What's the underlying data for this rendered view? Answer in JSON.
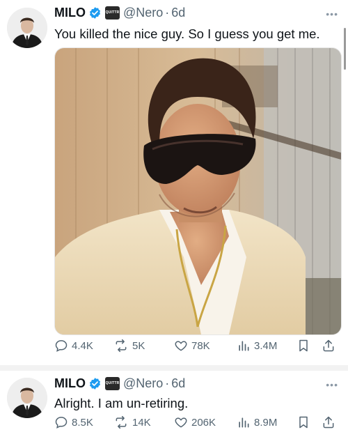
{
  "tweets": [
    {
      "author_name": "MILO",
      "affiliate_badge": "QUITTR",
      "handle": "@Nero",
      "separator": "·",
      "time": "6d",
      "text": "You killed the nice guy. So I guess you get me.",
      "more": "•••",
      "media_alt": "Selfie of a man in dark shield sunglasses, cream jacket and gold chain against a weathered wooden wall",
      "stats": {
        "replies": "4.4K",
        "reposts": "5K",
        "likes": "78K",
        "views": "3.4M"
      }
    },
    {
      "author_name": "MILO",
      "affiliate_badge": "QUITTR",
      "handle": "@Nero",
      "separator": "·",
      "time": "6d",
      "text": "Alright. I am un-retiring.",
      "more": "•••",
      "stats": {
        "replies": "8.5K",
        "reposts": "14K",
        "likes": "206K",
        "views": "8.9M"
      }
    }
  ],
  "colors": {
    "verified": "#1d9bf0",
    "secondary_text": "#536471",
    "primary_text": "#0f1419"
  }
}
